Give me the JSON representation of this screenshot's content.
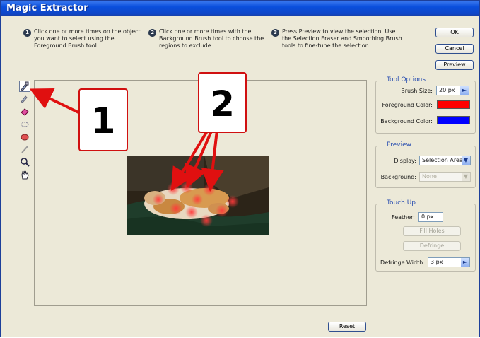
{
  "window": {
    "title": "Magic Extractor"
  },
  "instructions": [
    {
      "num": "1",
      "text": "Click one or more times on the object you want to select using the Foreground Brush tool."
    },
    {
      "num": "2",
      "text": "Click one or more times with the Background Brush tool to choose the regions to exclude."
    },
    {
      "num": "3",
      "text": "Press Preview to view the selection. Use the Selection Eraser and Smoothing Brush tools to fine-tune the selection."
    }
  ],
  "buttons": {
    "ok": "OK",
    "cancel": "Cancel",
    "preview": "Preview",
    "reset": "Reset",
    "fill_holes": "Fill Holes",
    "defringe": "Defringe"
  },
  "tool_options": {
    "legend": "Tool Options",
    "brush_size_label": "Brush Size:",
    "brush_size_value": "20 px",
    "foreground_label": "Foreground Color:",
    "background_label": "Background Color:",
    "foreground_color": "#ff0000",
    "background_color": "#0000ff"
  },
  "preview": {
    "legend": "Preview",
    "display_label": "Display:",
    "display_value": "Selection Area",
    "background_label": "Background:",
    "background_value": "None"
  },
  "touch_up": {
    "legend": "Touch Up",
    "feather_label": "Feather:",
    "feather_value": "0 px",
    "defringe_width_label": "Defringe Width:",
    "defringe_width_value": "3 px"
  },
  "tools": [
    "foreground-brush-icon",
    "background-brush-icon",
    "point-eraser-icon",
    "hand-icon"
  ],
  "annotations": {
    "callout_1": "1",
    "callout_2": "2"
  }
}
